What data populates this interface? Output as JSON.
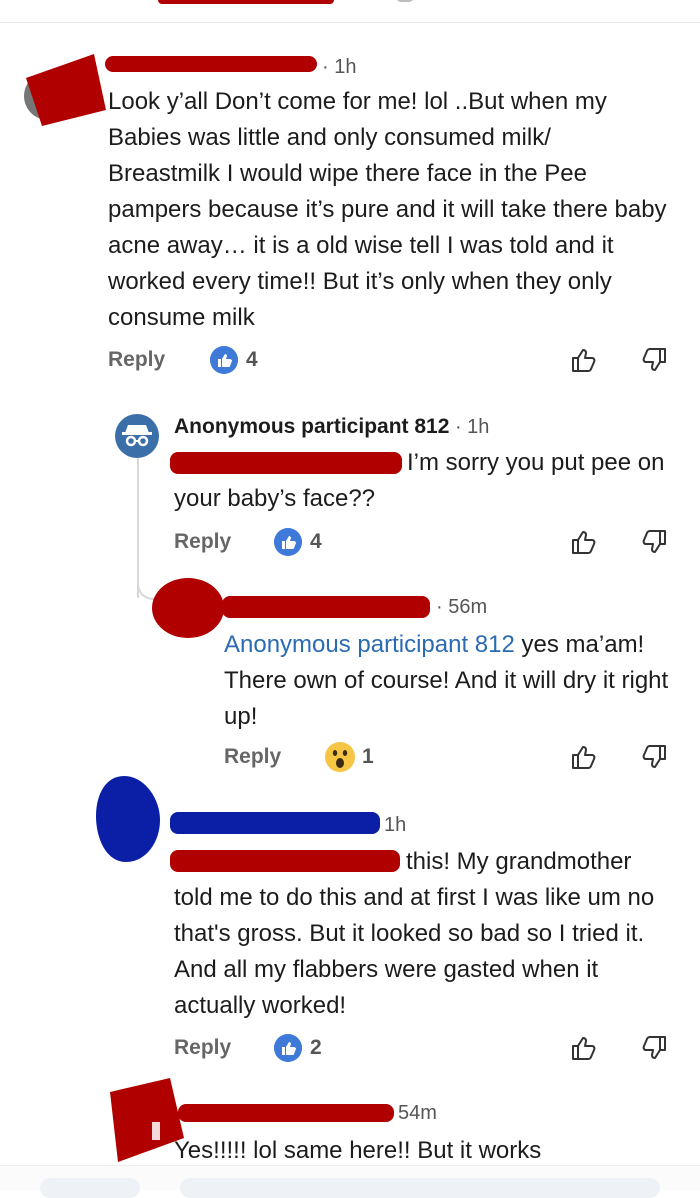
{
  "ui": {
    "reply_label": "Reply"
  },
  "comments": [
    {
      "time": "· 1h",
      "text": "Look y’all Don’t come for me! lol ..But when my Babies was little and only consumed milk/ Breastmilk I would wipe there face in the Pee pampers because it’s pure and it will take there baby acne away… it is a old wise tell I was told and it worked every time!! But it’s only when they only consume milk",
      "reaction_icon": "like-icon",
      "reaction_count": "4"
    },
    {
      "author": "Anonymous participant 812",
      "time": "· 1h",
      "text": "I’m sorry you put pee on your baby’s face??",
      "reaction_icon": "like-icon",
      "reaction_count": "4"
    },
    {
      "time": "· 56m",
      "mention": "Anonymous participant 812",
      "text": " yes ma’am! There own of course! And it will dry it right up!",
      "reaction_icon": "wow-emoji-icon",
      "reaction_count": "1"
    },
    {
      "time": "1h",
      "text": "this! My grandmother told me to do this and at first I was like um no that's gross. But it looked so bad so I tried it. And all my flabbers were gasted when it actually worked!",
      "reaction_icon": "like-icon",
      "reaction_count": "2"
    },
    {
      "time": "54m",
      "text": "Yes!!!!! lol same here!! But it works"
    }
  ],
  "colors": {
    "like_blue": "#3f7ad9",
    "mention_blue": "#2a6bb3",
    "redaction_red": "#b00000",
    "redaction_blue": "#0a1fa6"
  }
}
